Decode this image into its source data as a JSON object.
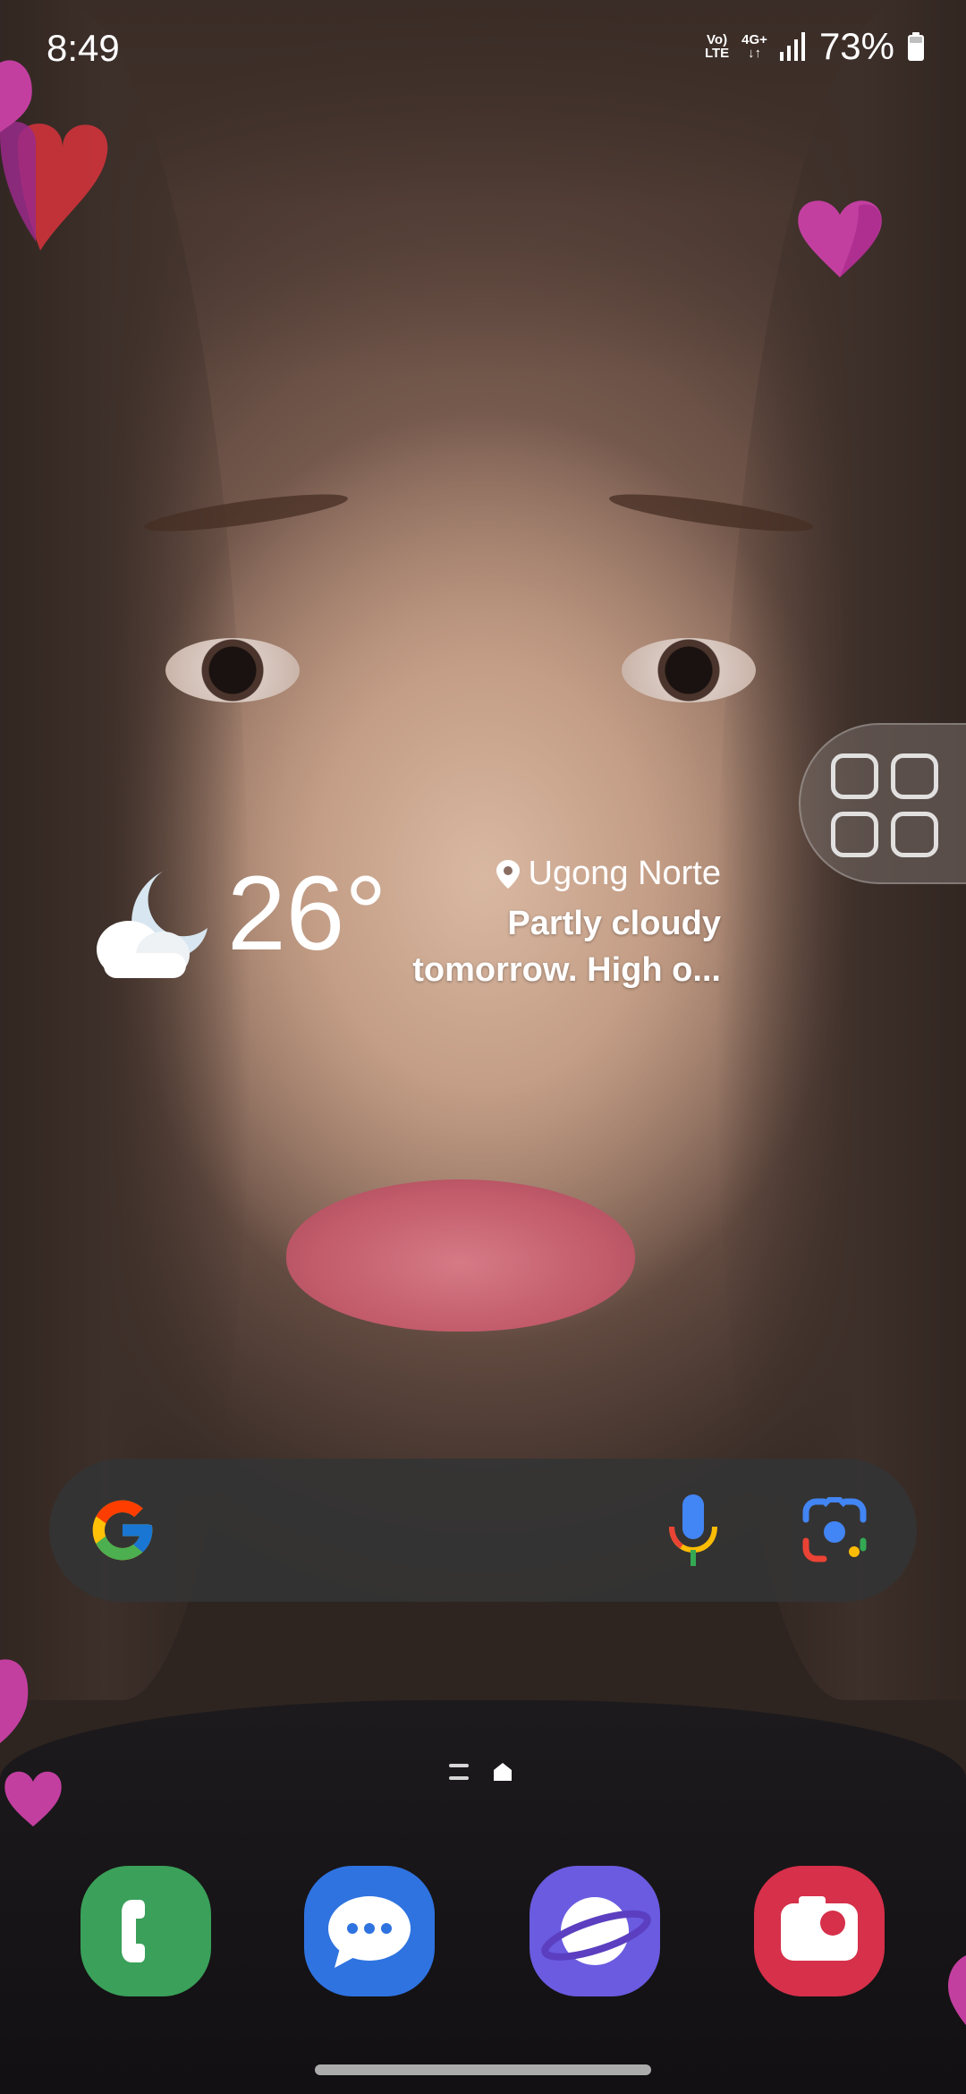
{
  "status_bar": {
    "time": "8:49",
    "volte_top": "Vo)",
    "volte_bottom": "LTE",
    "network_type": "4G+",
    "network_arrows": "↓↑",
    "battery_percent": "73%"
  },
  "weather": {
    "temperature": "26°",
    "location": "Ugong Norte",
    "forecast_line1": "Partly cloudy",
    "forecast_line2": "tomorrow. High o...",
    "icon": "partly-cloudy-night-icon"
  },
  "search_bar": {
    "logo": "google-g-icon",
    "mic_icon": "microphone-icon",
    "lens_icon": "google-lens-icon"
  },
  "dock": {
    "apps": [
      {
        "name": "Phone",
        "icon": "phone-icon",
        "color": "#3aa05a"
      },
      {
        "name": "Messages",
        "icon": "chat-bubble-icon",
        "color": "#2f73e0"
      },
      {
        "name": "Internet",
        "icon": "planet-icon",
        "color": "#6a5be0"
      },
      {
        "name": "Camera",
        "icon": "camera-icon",
        "color": "#d6304a"
      }
    ]
  },
  "edge_panel": {
    "icon": "app-grid-icon"
  },
  "colors": {
    "heart_pink": "#c23fa0",
    "heart_red": "#d8343c"
  }
}
